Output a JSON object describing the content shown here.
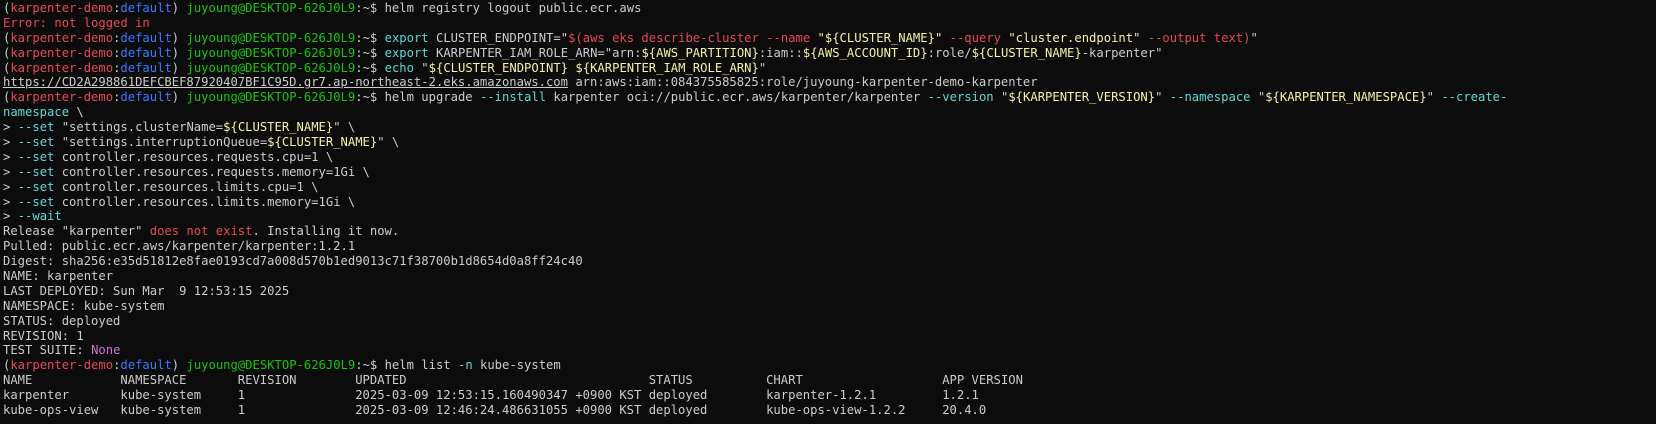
{
  "terminal": {
    "colors": {
      "background": "#0c0c0c",
      "default": "#cccccc",
      "red": "#e74856",
      "blue": "#3b78ff",
      "green": "#16c60c",
      "cyan": "#61d6d6",
      "yellow": "#f9f1a5",
      "magenta": "#d670d6"
    },
    "lines": [
      [
        {
          "t": "(",
          "c": "default"
        },
        {
          "t": "karpenter-demo",
          "c": "red"
        },
        {
          "t": ":",
          "c": "default"
        },
        {
          "t": "default",
          "c": "blue"
        },
        {
          "t": ") ",
          "c": "default"
        },
        {
          "t": "juyoung@DESKTOP-626J0L9",
          "c": "green"
        },
        {
          "t": ":~$ helm registry logout public.ecr.aws",
          "c": "default"
        }
      ],
      [
        {
          "t": "Error: not logged in",
          "c": "red"
        }
      ],
      [
        {
          "t": "(",
          "c": "default"
        },
        {
          "t": "karpenter-demo",
          "c": "red"
        },
        {
          "t": ":",
          "c": "default"
        },
        {
          "t": "default",
          "c": "blue"
        },
        {
          "t": ") ",
          "c": "default"
        },
        {
          "t": "juyoung@DESKTOP-626J0L9",
          "c": "green"
        },
        {
          "t": ":~$ ",
          "c": "default"
        },
        {
          "t": "export",
          "c": "cyan"
        },
        {
          "t": " CLUSTER_ENDPOINT=\"",
          "c": "default"
        },
        {
          "t": "$(aws eks describe-cluster --name ",
          "c": "red"
        },
        {
          "t": "\"${CLUSTER_NAME}\"",
          "c": "yellow"
        },
        {
          "t": " --query ",
          "c": "red"
        },
        {
          "t": "\"cluster.endpoint\"",
          "c": "yellow"
        },
        {
          "t": " --output text)",
          "c": "red"
        },
        {
          "t": "\"",
          "c": "default"
        }
      ],
      [
        {
          "t": "(",
          "c": "default"
        },
        {
          "t": "karpenter-demo",
          "c": "red"
        },
        {
          "t": ":",
          "c": "default"
        },
        {
          "t": "default",
          "c": "blue"
        },
        {
          "t": ") ",
          "c": "default"
        },
        {
          "t": "juyoung@DESKTOP-626J0L9",
          "c": "green"
        },
        {
          "t": ":~$ ",
          "c": "default"
        },
        {
          "t": "export",
          "c": "cyan"
        },
        {
          "t": " KARPENTER_IAM_ROLE_ARN=\"arn:",
          "c": "default"
        },
        {
          "t": "${AWS_PARTITION}",
          "c": "yellow"
        },
        {
          "t": ":iam::",
          "c": "default"
        },
        {
          "t": "${AWS_ACCOUNT_ID}",
          "c": "yellow"
        },
        {
          "t": ":role/",
          "c": "default"
        },
        {
          "t": "${CLUSTER_NAME}",
          "c": "yellow"
        },
        {
          "t": "-karpenter\"",
          "c": "default"
        }
      ],
      [
        {
          "t": "(",
          "c": "default"
        },
        {
          "t": "karpenter-demo",
          "c": "red"
        },
        {
          "t": ":",
          "c": "default"
        },
        {
          "t": "default",
          "c": "blue"
        },
        {
          "t": ") ",
          "c": "default"
        },
        {
          "t": "juyoung@DESKTOP-626J0L9",
          "c": "green"
        },
        {
          "t": ":~$ ",
          "c": "default"
        },
        {
          "t": "echo",
          "c": "cyan"
        },
        {
          "t": " \"",
          "c": "default"
        },
        {
          "t": "${CLUSTER_ENDPOINT}",
          "c": "yellow"
        },
        {
          "t": " ",
          "c": "default"
        },
        {
          "t": "${KARPENTER_IAM_ROLE_ARN}",
          "c": "yellow"
        },
        {
          "t": "\"",
          "c": "default"
        }
      ],
      [
        {
          "t": "https://CD2A298861DEFCBEF87920407BF1C95D.gr7.ap-northeast-2.eks.amazonaws.com",
          "c": "link"
        },
        {
          "t": " arn:aws:iam::084375585825:role/juyoung-karpenter-demo-karpenter",
          "c": "default"
        }
      ],
      [
        {
          "t": "(",
          "c": "default"
        },
        {
          "t": "karpenter-demo",
          "c": "red"
        },
        {
          "t": ":",
          "c": "default"
        },
        {
          "t": "default",
          "c": "blue"
        },
        {
          "t": ") ",
          "c": "default"
        },
        {
          "t": "juyoung@DESKTOP-626J0L9",
          "c": "green"
        },
        {
          "t": ":~$ helm upgrade ",
          "c": "default"
        },
        {
          "t": "--install",
          "c": "cyan"
        },
        {
          "t": " karpenter oci://public.ecr.aws/karpenter/karpenter ",
          "c": "default"
        },
        {
          "t": "--version",
          "c": "cyan"
        },
        {
          "t": " \"",
          "c": "default"
        },
        {
          "t": "${KARPENTER_VERSION}",
          "c": "yellow"
        },
        {
          "t": "\" ",
          "c": "default"
        },
        {
          "t": "--namespace",
          "c": "cyan"
        },
        {
          "t": " \"",
          "c": "default"
        },
        {
          "t": "${KARPENTER_NAMESPACE}",
          "c": "yellow"
        },
        {
          "t": "\" ",
          "c": "default"
        },
        {
          "t": "--create-",
          "c": "cyan"
        }
      ],
      [
        {
          "t": "namespace",
          "c": "cyan"
        },
        {
          "t": " \\",
          "c": "default"
        }
      ],
      [
        {
          "t": "> ",
          "c": "default"
        },
        {
          "t": "--set",
          "c": "cyan"
        },
        {
          "t": " \"settings.clusterName=",
          "c": "default"
        },
        {
          "t": "${CLUSTER_NAME}",
          "c": "yellow"
        },
        {
          "t": "\" \\",
          "c": "default"
        }
      ],
      [
        {
          "t": "> ",
          "c": "default"
        },
        {
          "t": "--set",
          "c": "cyan"
        },
        {
          "t": " \"settings.interruptionQueue=",
          "c": "default"
        },
        {
          "t": "${CLUSTER_NAME}",
          "c": "yellow"
        },
        {
          "t": "\" \\",
          "c": "default"
        }
      ],
      [
        {
          "t": "> ",
          "c": "default"
        },
        {
          "t": "--set",
          "c": "cyan"
        },
        {
          "t": " controller.resources.requests.cpu=1 \\",
          "c": "default"
        }
      ],
      [
        {
          "t": "> ",
          "c": "default"
        },
        {
          "t": "--set",
          "c": "cyan"
        },
        {
          "t": " controller.resources.requests.memory=1Gi \\",
          "c": "default"
        }
      ],
      [
        {
          "t": "> ",
          "c": "default"
        },
        {
          "t": "--set",
          "c": "cyan"
        },
        {
          "t": " controller.resources.limits.cpu=1 \\",
          "c": "default"
        }
      ],
      [
        {
          "t": "> ",
          "c": "default"
        },
        {
          "t": "--set",
          "c": "cyan"
        },
        {
          "t": " controller.resources.limits.memory=1Gi \\",
          "c": "default"
        }
      ],
      [
        {
          "t": "> ",
          "c": "default"
        },
        {
          "t": "--wait",
          "c": "cyan"
        }
      ],
      [
        {
          "t": "Release \"karpenter\" ",
          "c": "default"
        },
        {
          "t": "does not exist",
          "c": "red"
        },
        {
          "t": ". Installing it now.",
          "c": "default"
        }
      ],
      [
        {
          "t": "Pulled: public.ecr.aws/karpenter/karpenter:1.2.1",
          "c": "default"
        }
      ],
      [
        {
          "t": "Digest: sha256:e35d51812e8fae0193cd7a008d570b1ed9013c71f38700b1d8654d0a8ff24c40",
          "c": "default"
        }
      ],
      [
        {
          "t": "NAME: karpenter",
          "c": "default"
        }
      ],
      [
        {
          "t": "LAST DEPLOYED: Sun Mar  9 12:53:15 2025",
          "c": "default"
        }
      ],
      [
        {
          "t": "NAMESPACE: kube-system",
          "c": "default"
        }
      ],
      [
        {
          "t": "STATUS: deployed",
          "c": "default"
        }
      ],
      [
        {
          "t": "REVISION: 1",
          "c": "default"
        }
      ],
      [
        {
          "t": "TEST SUITE: ",
          "c": "default"
        },
        {
          "t": "None",
          "c": "magenta"
        }
      ],
      [
        {
          "t": "(",
          "c": "default"
        },
        {
          "t": "karpenter-demo",
          "c": "red"
        },
        {
          "t": ":",
          "c": "default"
        },
        {
          "t": "default",
          "c": "blue"
        },
        {
          "t": ") ",
          "c": "default"
        },
        {
          "t": "juyoung@DESKTOP-626J0L9",
          "c": "green"
        },
        {
          "t": ":~$ helm list ",
          "c": "default"
        },
        {
          "t": "-n",
          "c": "cyan"
        },
        {
          "t": " kube-system",
          "c": "default"
        }
      ],
      [
        {
          "t": "NAME            NAMESPACE       REVISION        UPDATED                                 STATUS          CHART                   APP VERSION",
          "c": "default"
        }
      ],
      [
        {
          "t": "karpenter       kube-system     1               2025-03-09 12:53:15.160490347 +0900 KST deployed        karpenter-1.2.1         1.2.1",
          "c": "default"
        }
      ],
      [
        {
          "t": "kube-ops-view   kube-system     1               2025-03-09 12:46:24.486631055 +0900 KST deployed        kube-ops-view-1.2.2     20.4.0",
          "c": "default"
        }
      ]
    ]
  }
}
